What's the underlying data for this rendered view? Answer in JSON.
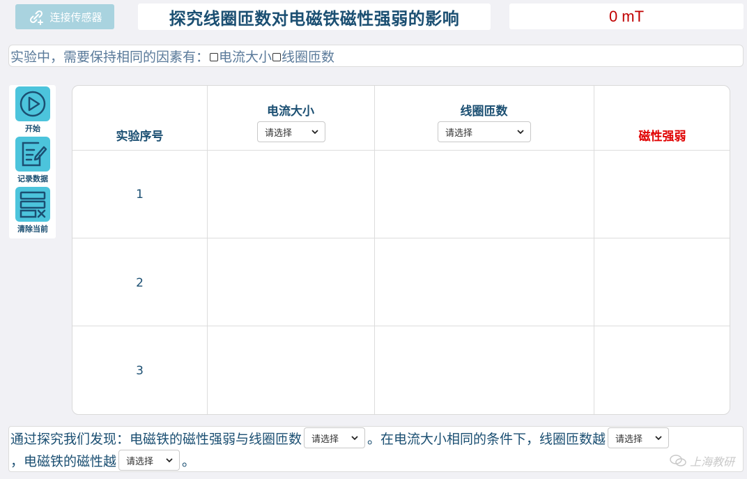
{
  "header": {
    "connect_label": "连接传感器",
    "title": "探究线圈匝数对电磁铁磁性强弱的影响",
    "reading": "0 mT"
  },
  "factors": {
    "prefix": "实验中，需要保持相同的因素有：",
    "options": [
      "电流大小",
      "线圈匝数"
    ]
  },
  "toolbar": {
    "start_label": "开始",
    "record_label": "记录数据",
    "clear_label": "清除当前"
  },
  "table": {
    "headers": {
      "seq": "实验序号",
      "current": "电流大小",
      "turns": "线圈匝数",
      "strength": "磁性强弱"
    },
    "current_select": "请选择",
    "turns_select": "请选择",
    "rows": [
      "1",
      "2",
      "3"
    ]
  },
  "conclusion": {
    "part1": "通过探究我们发现：电磁铁的磁性强弱与线圈匝数",
    "select1": "请选择",
    "part2": "。在电流大小相同的条件下，线圈匝数越",
    "select2": "请选择",
    "part3": "，电磁铁的磁性越",
    "select3": "请选择",
    "part4": "。"
  },
  "watermark": "上海教研",
  "colors": {
    "accent": "#4cc4dc",
    "title": "#1b4f72",
    "reading": "#c00000",
    "strength_header": "#e00000"
  }
}
